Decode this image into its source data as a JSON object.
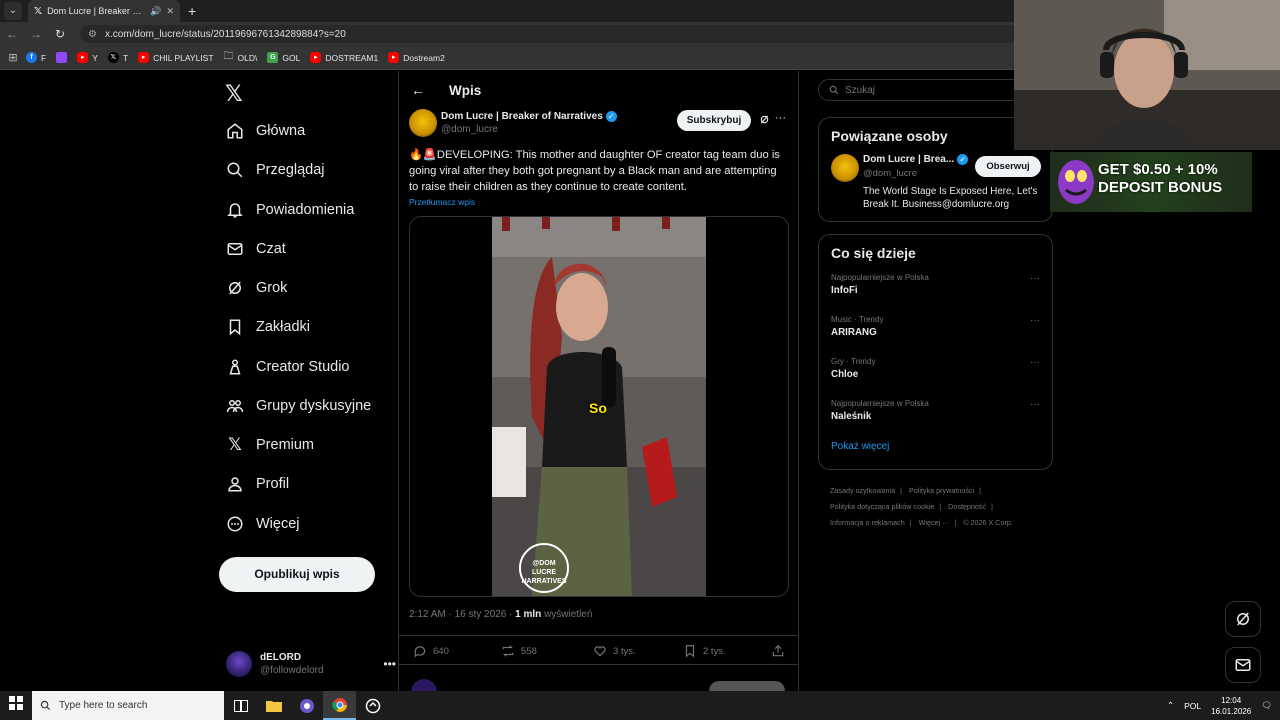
{
  "browser": {
    "tab_title": "Dom Lucre | Breaker of Narr",
    "url": "x.com/dom_lucre/status/2011969676134289884?s=20",
    "bookmarks": [
      {
        "label": "F",
        "color": "#1877f2"
      },
      {
        "label": "",
        "color": "#9146ff"
      },
      {
        "label": "Y",
        "color": "#ff0000"
      },
      {
        "label": "T",
        "color": "#000000"
      },
      {
        "label": "CHIL PLAYLIST",
        "color": "#ff0000"
      },
      {
        "label": "OLD\\",
        "color": "folder"
      },
      {
        "label": "GOL",
        "color": "#3fa34d"
      },
      {
        "label": "DOSTREAM1",
        "color": "#ff0000"
      },
      {
        "label": "Dostream2",
        "color": "#ff0000"
      }
    ]
  },
  "nav": {
    "items": [
      {
        "label": "Główna",
        "icon": "home-icon"
      },
      {
        "label": "Przeglądaj",
        "icon": "search-icon"
      },
      {
        "label": "Powiadomienia",
        "icon": "bell-icon"
      },
      {
        "label": "Czat",
        "icon": "mail-icon"
      },
      {
        "label": "Grok",
        "icon": "grok-icon"
      },
      {
        "label": "Zakładki",
        "icon": "bookmark-icon"
      },
      {
        "label": "Creator Studio",
        "icon": "creator-icon"
      },
      {
        "label": "Grupy dyskusyjne",
        "icon": "people-icon"
      },
      {
        "label": "Premium",
        "icon": "x-icon"
      },
      {
        "label": "Profil",
        "icon": "person-icon"
      },
      {
        "label": "Więcej",
        "icon": "more-circle-icon"
      }
    ],
    "post_button": "Opublikuj wpis",
    "me": {
      "name": "dELORD",
      "handle": "@followdelord"
    }
  },
  "post": {
    "header": "Wpis",
    "author_name": "Dom Lucre | Breaker of Narratives",
    "author_handle": "@dom_lucre",
    "subscribe_label": "Subskrybuj",
    "text": "🔥🚨DEVELOPING: This mother and daughter OF creator tag team duo is going viral after they both got pregnant by a Black man and are attempting to raise their children as they continue to create content.",
    "translate_label": "Przetłumacz wpis",
    "video_caption": "So",
    "watermark": "@DOM LUCRE NARRATIVES",
    "time": "2:12 AM · 16 sty 2026 · ",
    "views_count": "1 mln",
    "views_label": " wyświetleń",
    "replies": "640",
    "reposts": "558",
    "likes": "3 tys.",
    "bookmarks": "2 tys."
  },
  "sidebar": {
    "search_placeholder": "Szukaj",
    "related_title": "Powiązane osoby",
    "related": {
      "name": "Dom Lucre | Brea...",
      "handle": "@dom_lucre",
      "follow_label": "Obserwuj",
      "bio": "The World Stage Is Exposed Here, Let's Break It. Business@domlucre.org"
    },
    "trends_title": "Co się dzieje",
    "trends": [
      {
        "context": "Najpopularniejsze w Polska",
        "name": "InfoFi"
      },
      {
        "context": "Music · Trendy",
        "name": "ARIRANG"
      },
      {
        "context": "Gry · Trendy",
        "name": "Chloe"
      },
      {
        "context": "Najpopularniejsze w Polska",
        "name": "Naleśnik"
      }
    ],
    "show_more": "Pokaż więcej",
    "footer": [
      [
        "Zasady użytkowania",
        "|",
        "Polityka prywatności",
        "|"
      ],
      [
        "Polityka dotycząca plików cookie",
        "|",
        "Dostępność",
        "|"
      ],
      [
        "Informacja o reklamach",
        "|",
        "Więcej ···",
        "|",
        "© 2026 X Corp."
      ]
    ]
  },
  "promo": {
    "line1": "GET $0.50 + 10%",
    "line2": "DEPOSIT BONUS"
  },
  "taskbar": {
    "search_placeholder": "Type here to search",
    "lang": "POL",
    "time": "12:04",
    "date": "16.01.2026"
  }
}
